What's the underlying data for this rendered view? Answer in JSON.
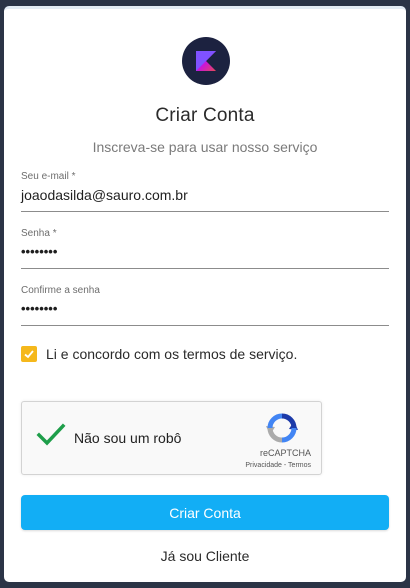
{
  "header": {
    "logo_icon": "kotlin-logo-icon",
    "title": "Criar Conta",
    "subtitle": "Inscreva-se para usar nosso serviço"
  },
  "form": {
    "email": {
      "label": "Seu e-mail *",
      "value": "joaodasilda@sauro.com.br"
    },
    "password": {
      "label": "Senha *",
      "value": "••••••••"
    },
    "confirm": {
      "label": "Confirme a senha",
      "value": "••••••••"
    },
    "terms": {
      "label": "Li e concordo com os termos de serviço.",
      "checked": true
    }
  },
  "captcha": {
    "label": "Não sou um robô",
    "brand": "reCAPTCHA",
    "links": "Privacidade - Termos",
    "checked": true
  },
  "actions": {
    "submit_label": "Criar Conta",
    "client_link": "Já sou Cliente"
  },
  "colors": {
    "primary": "#12aef5",
    "checkbox": "#f5b81c",
    "logo_bg": "#1c2240"
  }
}
